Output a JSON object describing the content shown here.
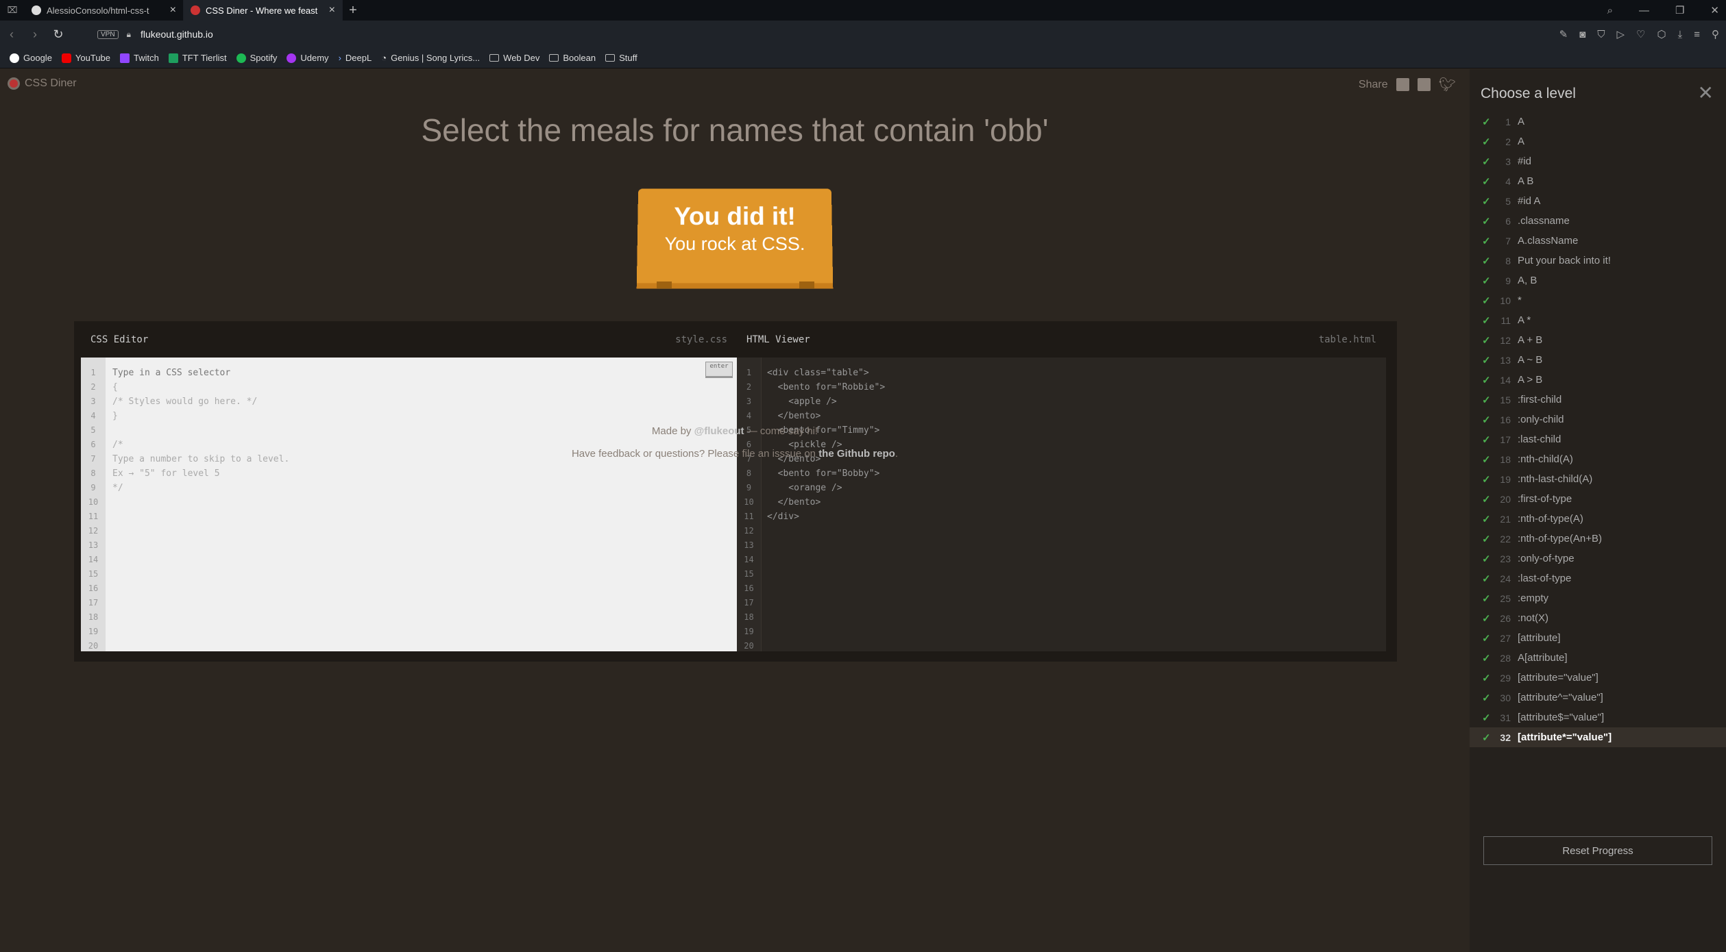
{
  "browser": {
    "tabs": [
      {
        "title": "AlessioConsolo/html-css-t",
        "active": false
      },
      {
        "title": "CSS Diner - Where we feast",
        "active": true
      }
    ],
    "url": "flukeout.github.io",
    "vpn_label": "VPN",
    "bookmarks": [
      "Google",
      "YouTube",
      "Twitch",
      "TFT Tierlist",
      "Spotify",
      "Udemy",
      "DeepL",
      "Genius | Song Lyrics...",
      "Web Dev",
      "Boolean",
      "Stuff"
    ]
  },
  "app": {
    "logo_text": "CSS Diner",
    "share_label": "Share",
    "order_text": "Select the meals for names that contain 'obb'",
    "win_line1": "You did it!",
    "win_line2": "You rock at CSS."
  },
  "editor": {
    "css_title": "CSS Editor",
    "css_file": "style.css",
    "html_title": "HTML Viewer",
    "html_file": "table.html",
    "enter_label": "enter",
    "line_numbers": [
      "1",
      "2",
      "3",
      "4",
      "5",
      "6",
      "7",
      "8",
      "9",
      "10",
      "11",
      "12",
      "13",
      "14",
      "15",
      "16",
      "17",
      "18",
      "19",
      "20"
    ],
    "css_lines": [
      "Type in a CSS selector",
      "{",
      "/* Styles would go here. */",
      "}",
      "",
      "/*",
      "Type a number to skip to a level.",
      "Ex → \"5\" for level 5",
      "*/"
    ],
    "html_lines": [
      "<div class=\"table\">",
      "  <bento for=\"Robbie\">",
      "    <apple />",
      "  </bento>",
      "  <bento for=\"Timmy\">",
      "    <pickle />",
      "  </bento>",
      "  <bento for=\"Bobby\">",
      "    <orange />",
      "  </bento>",
      "</div>"
    ]
  },
  "footer": {
    "made_by_prefix": "Made by ",
    "made_by_link": "@flukeout",
    "made_by_suffix": " — come say hi!",
    "feedback_prefix": "Have feedback or questions? Please file an isssue on ",
    "feedback_link": "the Github repo",
    "feedback_suffix": "."
  },
  "sidebar": {
    "title": "Choose a level",
    "reset_label": "Reset Progress",
    "current_level": 32,
    "levels": [
      {
        "num": "1",
        "label": "A",
        "done": true
      },
      {
        "num": "2",
        "label": "A",
        "done": true
      },
      {
        "num": "3",
        "label": "#id",
        "done": true
      },
      {
        "num": "4",
        "label": "A B",
        "done": true
      },
      {
        "num": "5",
        "label": "#id A",
        "done": true
      },
      {
        "num": "6",
        "label": ".classname",
        "done": true
      },
      {
        "num": "7",
        "label": "A.className",
        "done": true
      },
      {
        "num": "8",
        "label": "Put your back into it!",
        "done": true
      },
      {
        "num": "9",
        "label": "A, B",
        "done": true
      },
      {
        "num": "10",
        "label": "*",
        "done": true
      },
      {
        "num": "11",
        "label": "A *",
        "done": true
      },
      {
        "num": "12",
        "label": "A + B",
        "done": true
      },
      {
        "num": "13",
        "label": "A ~ B",
        "done": true
      },
      {
        "num": "14",
        "label": "A > B",
        "done": true
      },
      {
        "num": "15",
        "label": ":first-child",
        "done": true
      },
      {
        "num": "16",
        "label": ":only-child",
        "done": true
      },
      {
        "num": "17",
        "label": ":last-child",
        "done": true
      },
      {
        "num": "18",
        "label": ":nth-child(A)",
        "done": true
      },
      {
        "num": "19",
        "label": ":nth-last-child(A)",
        "done": true
      },
      {
        "num": "20",
        "label": ":first-of-type",
        "done": true
      },
      {
        "num": "21",
        "label": ":nth-of-type(A)",
        "done": true
      },
      {
        "num": "22",
        "label": ":nth-of-type(An+B)",
        "done": true
      },
      {
        "num": "23",
        "label": ":only-of-type",
        "done": true
      },
      {
        "num": "24",
        "label": ":last-of-type",
        "done": true
      },
      {
        "num": "25",
        "label": ":empty",
        "done": true
      },
      {
        "num": "26",
        "label": ":not(X)",
        "done": true
      },
      {
        "num": "27",
        "label": "[attribute]",
        "done": true
      },
      {
        "num": "28",
        "label": "A[attribute]",
        "done": true
      },
      {
        "num": "29",
        "label": "[attribute=\"value\"]",
        "done": true
      },
      {
        "num": "30",
        "label": "[attribute^=\"value\"]",
        "done": true
      },
      {
        "num": "31",
        "label": "[attribute$=\"value\"]",
        "done": true
      },
      {
        "num": "32",
        "label": "[attribute*=\"value\"]",
        "done": true
      }
    ]
  },
  "colors": {
    "accent": "#e0962a",
    "check": "#4caf50",
    "background": "#2c2620"
  }
}
